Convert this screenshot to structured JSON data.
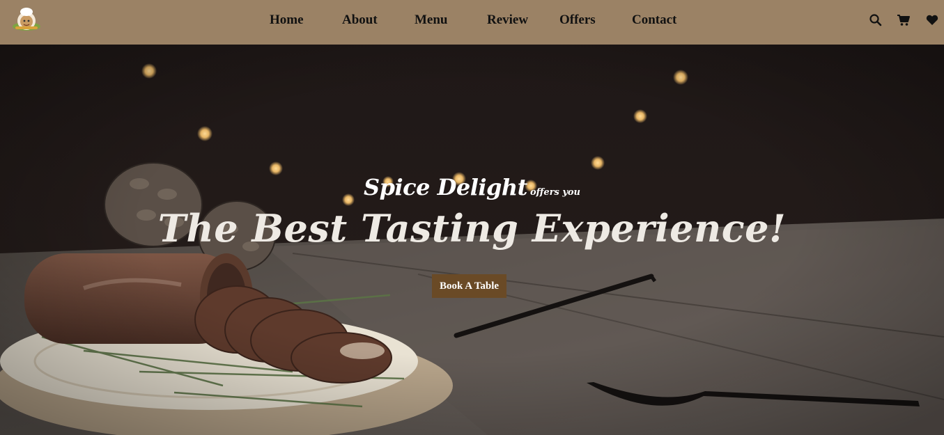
{
  "nav": {
    "logo_icon": "chef-mascot-logo",
    "links": [
      "Home",
      "About",
      "Menu",
      "Review",
      "Offers",
      "Contact"
    ],
    "icons": [
      "search-icon",
      "cart-icon",
      "heart-icon"
    ]
  },
  "hero": {
    "brand": "Spice Delight",
    "offers_text": "offers you",
    "headline": "The Best Tasting Experience!",
    "cta_label": "Book A Table"
  },
  "colors": {
    "navbar_bg": "#9b8265",
    "button_bg": "#6a4a26",
    "hero_text": "#ffffff"
  }
}
